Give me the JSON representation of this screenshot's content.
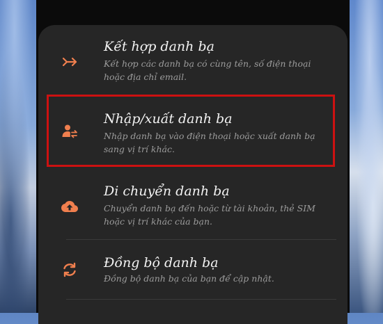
{
  "colors": {
    "accent": "#f07f4e",
    "highlight": "#cc1111",
    "sheet": "#262626"
  },
  "menu": {
    "items": [
      {
        "title": "Kết hợp danh bạ",
        "description": "Kết hợp các danh bạ có cùng tên, số điện thoại hoặc địa chỉ email.",
        "icon": "merge-arrows-icon"
      },
      {
        "title": "Nhập/xuất danh bạ",
        "description": "Nhập danh bạ vào điện thoại hoặc xuất danh bạ sang vị trí khác.",
        "icon": "contact-transfer-icon"
      },
      {
        "title": "Di chuyển danh bạ",
        "description": "Chuyển danh bạ đến hoặc từ tài khoản, thẻ SIM hoặc vị trí khác của bạn.",
        "icon": "cloud-upload-icon"
      },
      {
        "title": "Đồng bộ danh bạ",
        "description": "Đồng bộ danh bạ của bạn để cập nhật.",
        "icon": "sync-icon"
      }
    ]
  }
}
